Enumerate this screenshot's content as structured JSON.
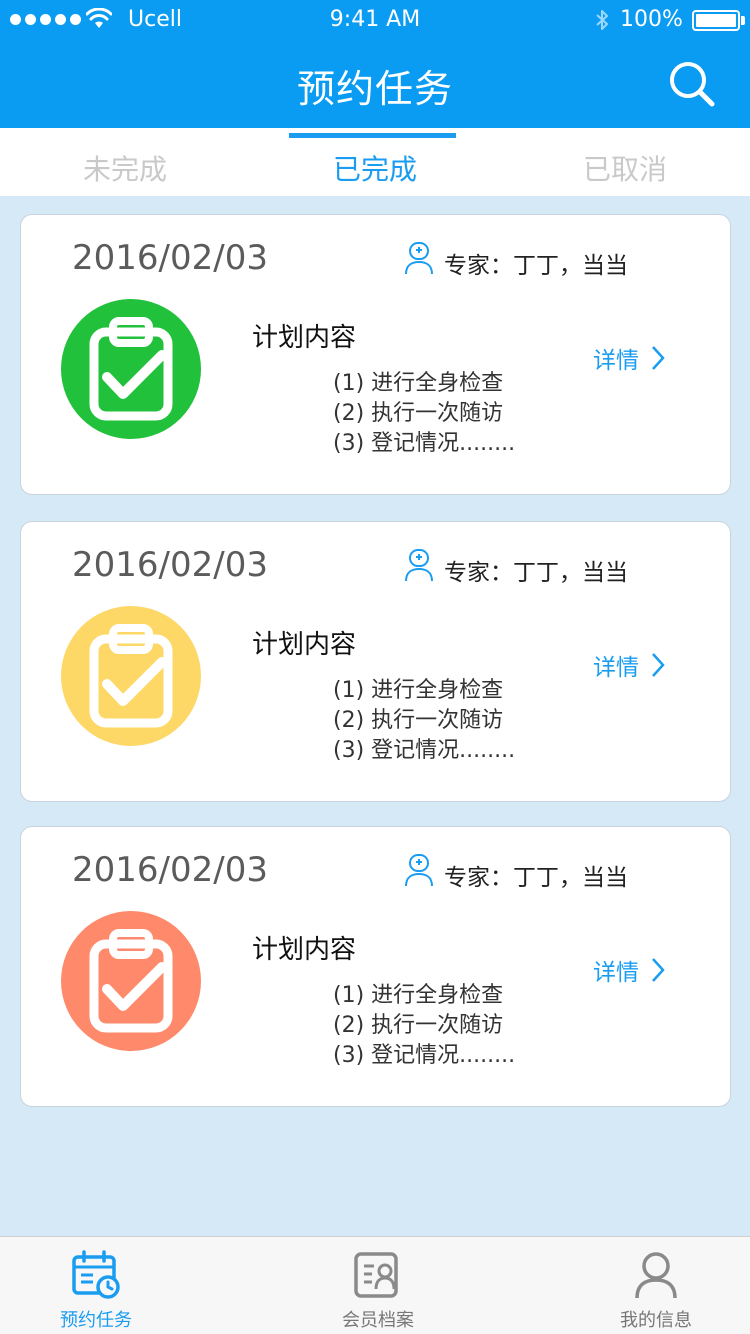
{
  "status_bar": {
    "carrier": "Ucell",
    "time": "9:41 AM",
    "battery": "100%"
  },
  "header": {
    "title": "预约任务",
    "search_icon": "search-icon",
    "color": "#0a9cf2"
  },
  "tabs": [
    {
      "label": "未完成",
      "active": false
    },
    {
      "label": "已完成",
      "active": true
    },
    {
      "label": "已取消",
      "active": false
    }
  ],
  "cards": [
    {
      "date": "2016/02/03",
      "expert": "专家：丁丁，当当",
      "icon_color": "#21c13b",
      "plan_title": "计划内容",
      "items": [
        "(1) 进行全身检查",
        "(2) 执行一次随访",
        "(3) 登记情况........"
      ],
      "detail_label": "详情"
    },
    {
      "date": "2016/02/03",
      "expert": "专家：丁丁，当当",
      "icon_color": "#fdd867",
      "plan_title": "计划内容",
      "items": [
        "(1) 进行全身检查",
        "(2) 执行一次随访",
        "(3) 登记情况........"
      ],
      "detail_label": "详情"
    },
    {
      "date": "2016/02/03",
      "expert": "专家：丁丁，当当",
      "icon_color": "#fe8a6b",
      "plan_title": "计划内容",
      "items": [
        "(1) 进行全身检查",
        "(2) 执行一次随访",
        "(3) 登记情况........"
      ],
      "detail_label": "详情"
    }
  ],
  "bottom_nav": [
    {
      "label": "预约任务",
      "icon": "calendar-clock-icon",
      "active": true
    },
    {
      "label": "会员档案",
      "icon": "member-file-icon",
      "active": false
    },
    {
      "label": "我的信息",
      "icon": "user-icon",
      "active": false
    }
  ]
}
